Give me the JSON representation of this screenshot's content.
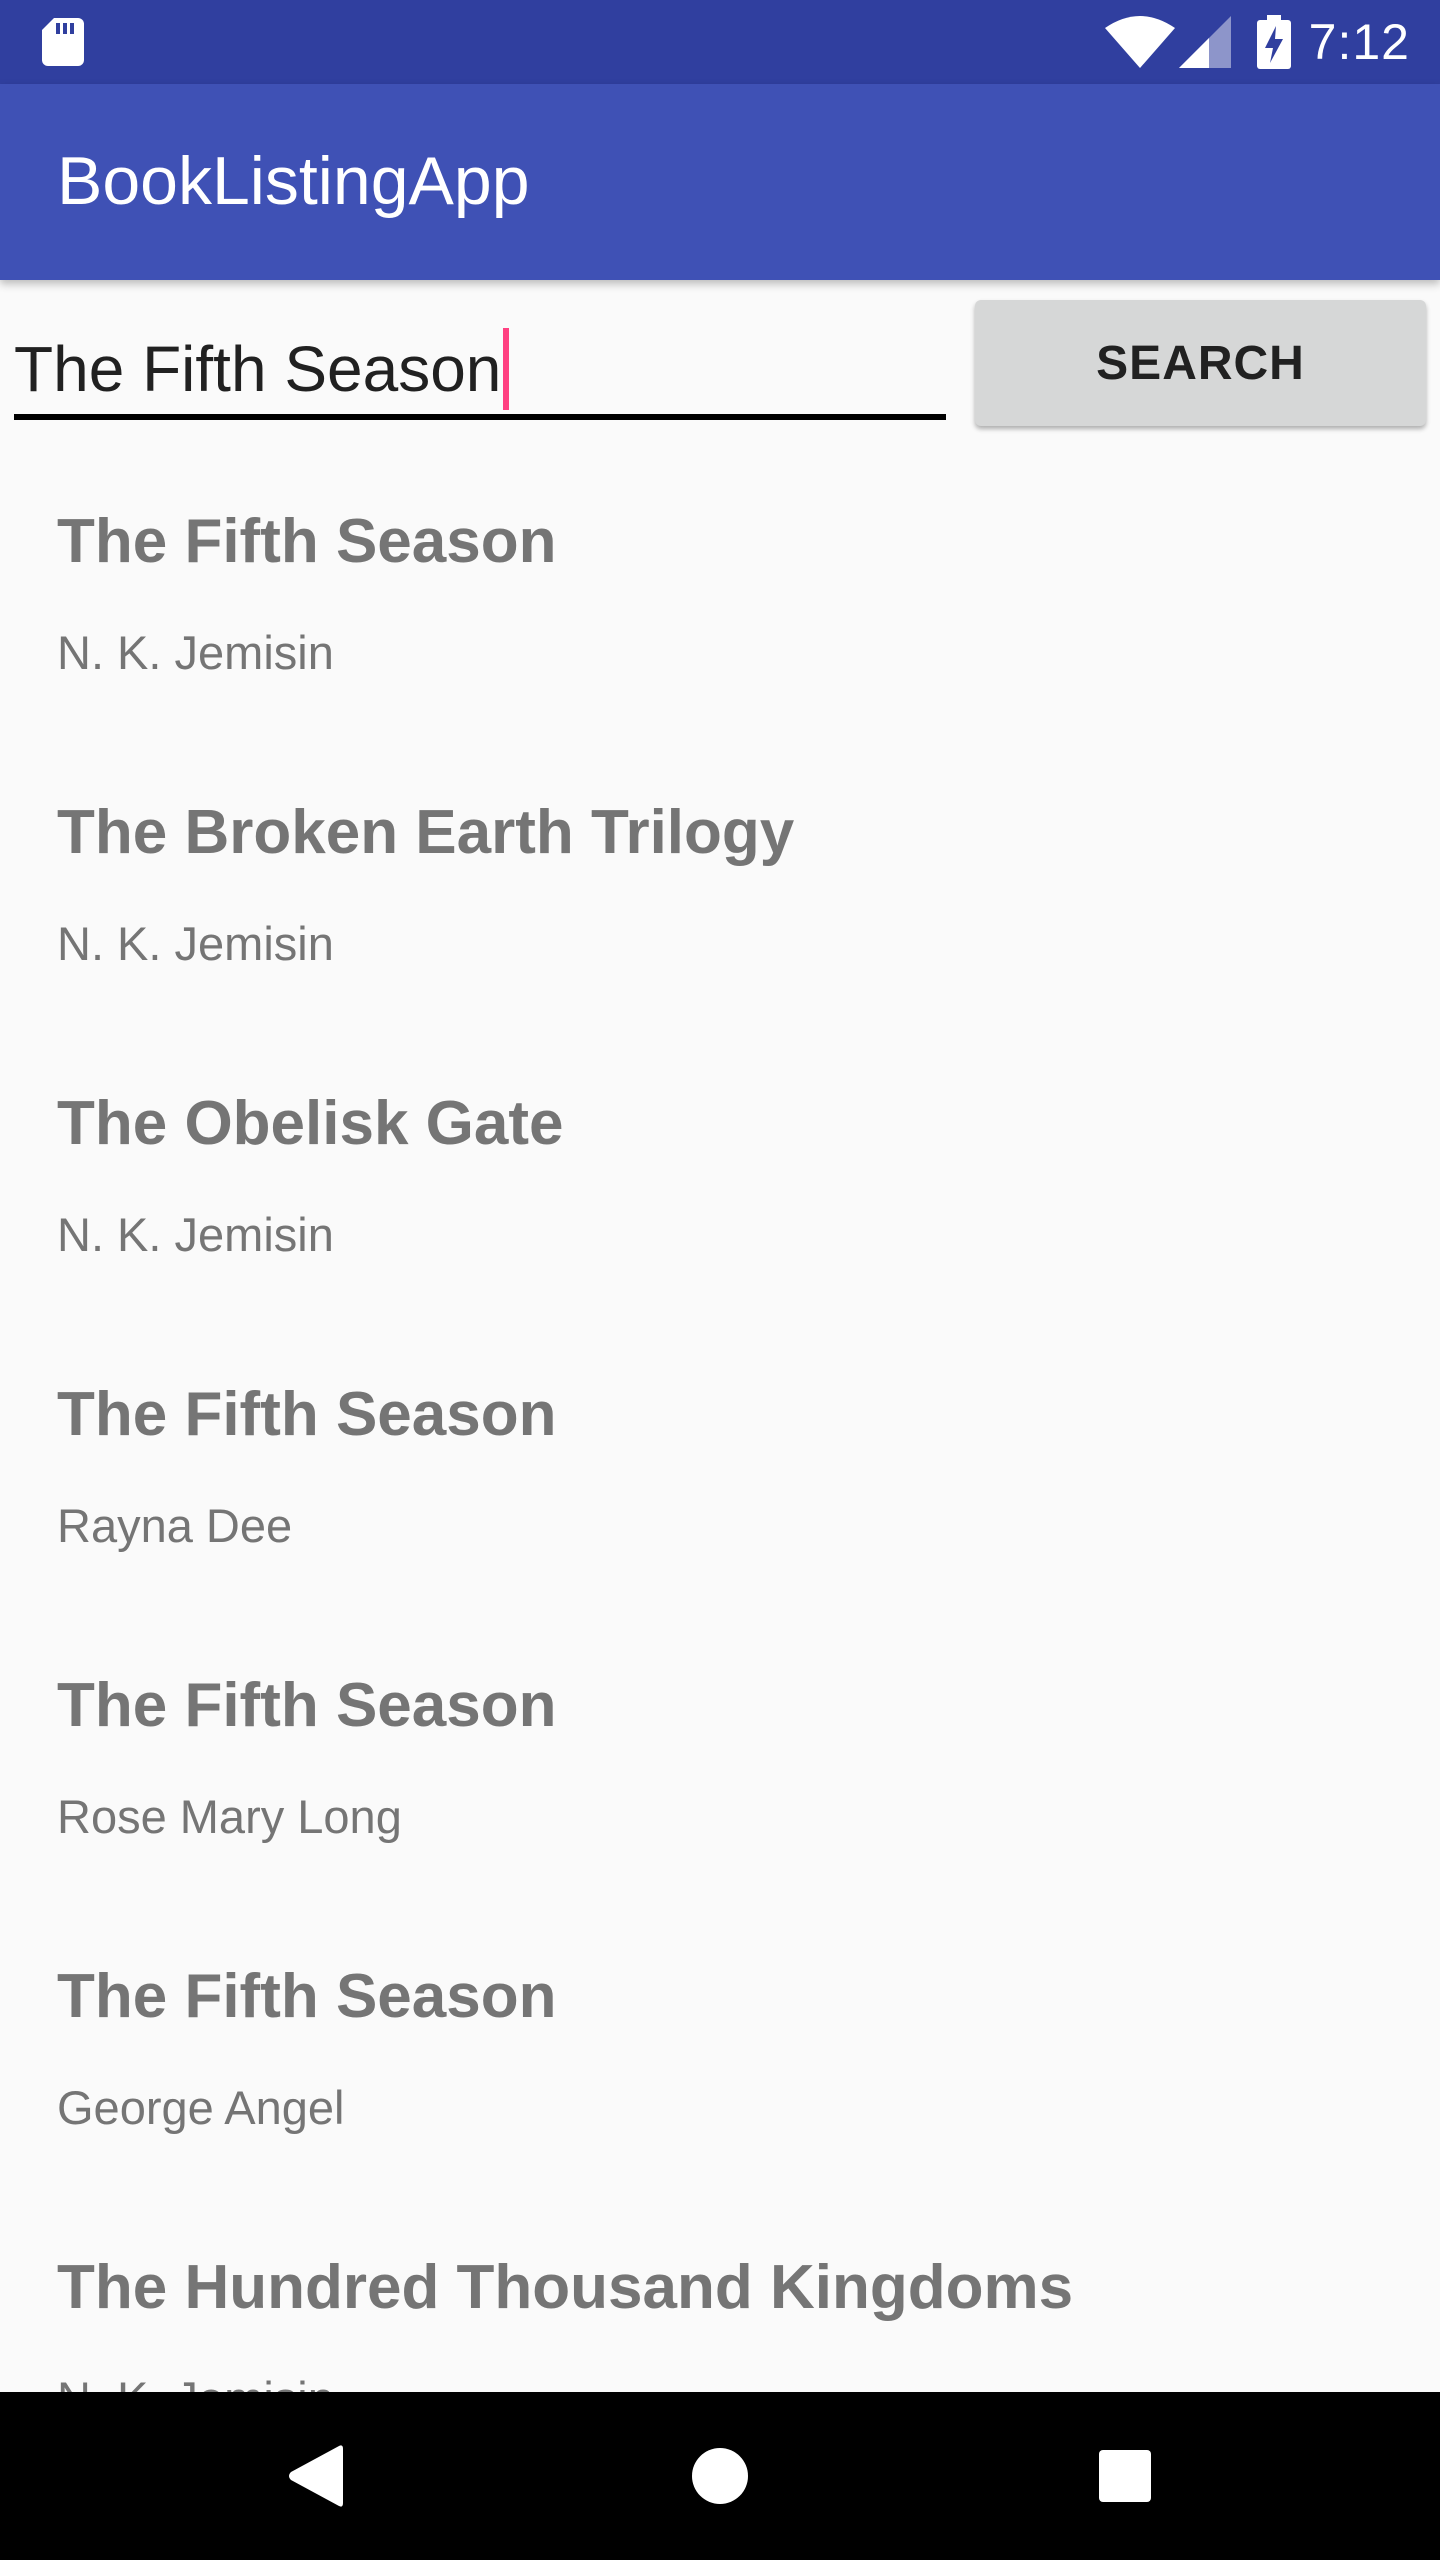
{
  "status_bar": {
    "time": "7:12",
    "icons": [
      "sd-card-icon",
      "wifi-icon",
      "signal-icon",
      "battery-charging-icon"
    ]
  },
  "app_bar": {
    "title": "BookListingApp"
  },
  "search": {
    "input_value": "The Fifth Season",
    "button_label": "SEARCH"
  },
  "books": [
    {
      "title": "The Fifth Season",
      "author": "N. K. Jemisin"
    },
    {
      "title": "The Broken Earth Trilogy",
      "author": "N. K. Jemisin"
    },
    {
      "title": "The Obelisk Gate",
      "author": "N. K. Jemisin"
    },
    {
      "title": "The Fifth Season",
      "author": "Rayna Dee"
    },
    {
      "title": "The Fifth Season",
      "author": "Rose Mary Long"
    },
    {
      "title": "The Fifth Season",
      "author": "George Angel"
    },
    {
      "title": "The Hundred Thousand Kingdoms",
      "author": "N. K. Jemisin"
    }
  ],
  "nav_bar": {
    "buttons": [
      "back-icon",
      "home-icon",
      "recents-icon"
    ]
  },
  "colors": {
    "status_bar": "#303f9f",
    "app_bar": "#3f51b5",
    "accent": "#ff4081"
  }
}
